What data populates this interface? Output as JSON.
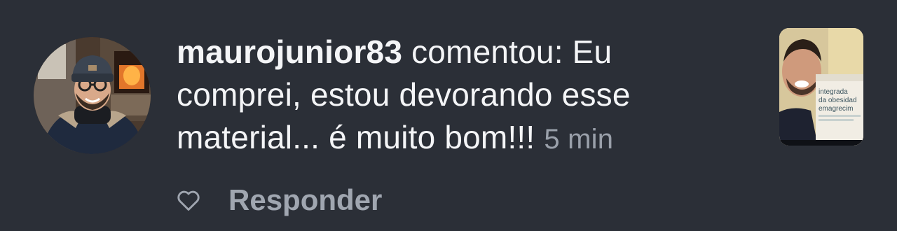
{
  "notification": {
    "username": "maurojunior83",
    "action_text": " comentou: Eu comprei, estou devorando esse material... é muito bom!!! ",
    "time": "5 min",
    "reply_label": "Responder",
    "like_icon": "heart-outline-icon",
    "thumbnail_book_title": "integrada da obesidade emagrecim"
  },
  "colors": {
    "background": "#2b2f37",
    "text": "#f4f5f7",
    "muted": "#9aa0aa"
  }
}
